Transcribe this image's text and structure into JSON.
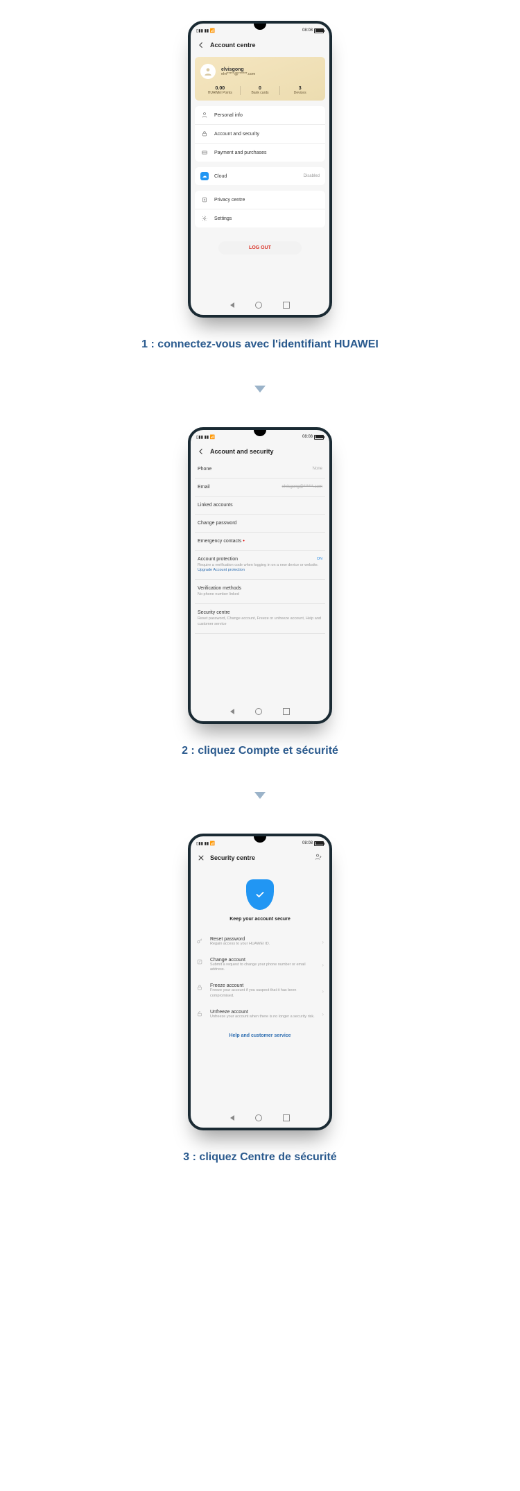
{
  "captions": {
    "step1": "1 : connectez-vous avec l'identifiant HUAWEI",
    "step2": "2 : cliquez Compte et sécurité",
    "step3": "3 : cliquez Centre de sécurité"
  },
  "statusbar": {
    "signal": "▪▪▪▫",
    "time": "08:08"
  },
  "screen1": {
    "title": "Account centre",
    "user": {
      "name": "elvisgong",
      "email": "elvi*****@******.com"
    },
    "stats": [
      {
        "value": "0.00",
        "label": "HUAWEI Points"
      },
      {
        "value": "0",
        "label": "Bank cards"
      },
      {
        "value": "3",
        "label": "Devices"
      }
    ],
    "menu": [
      {
        "label": "Personal info"
      },
      {
        "label": "Account and security"
      },
      {
        "label": "Payment and purchases"
      },
      {
        "label": "Cloud",
        "value": "Disabled",
        "cloud": true
      },
      {
        "label": "Privacy centre"
      },
      {
        "label": "Settings"
      }
    ],
    "logout": "LOG OUT"
  },
  "screen2": {
    "title": "Account and security",
    "rows": {
      "phone": {
        "label": "Phone",
        "value": "None"
      },
      "email": {
        "label": "Email",
        "value": "elvisgong@******.com"
      },
      "linked": {
        "label": "Linked accounts"
      },
      "changepw": {
        "label": "Change password"
      },
      "emergency": {
        "label": "Emergency contacts",
        "required": "•"
      },
      "protection": {
        "label": "Account protection",
        "desc": "Require a verification code when logging in on a new device or website.",
        "upgrade": "Upgrade Account protection",
        "state": "ON"
      },
      "verify": {
        "label": "Verification methods",
        "desc": "No phone number linked"
      },
      "seccentre": {
        "label": "Security centre",
        "desc": "Reset password, Change account, Freeze or unfreeze account, Help and customer service"
      }
    }
  },
  "screen3": {
    "title": "Security centre",
    "heading": "Keep your account secure",
    "items": [
      {
        "title": "Reset password",
        "desc": "Regain access to your HUAWEI ID."
      },
      {
        "title": "Change account",
        "desc": "Submit a request to change your phone number or email address."
      },
      {
        "title": "Freeze account",
        "desc": "Freeze your account if you suspect that it has been compromised."
      },
      {
        "title": "Unfreeze account",
        "desc": "Unfreeze your account when there is no longer a security risk."
      }
    ],
    "help": "Help and customer service"
  }
}
